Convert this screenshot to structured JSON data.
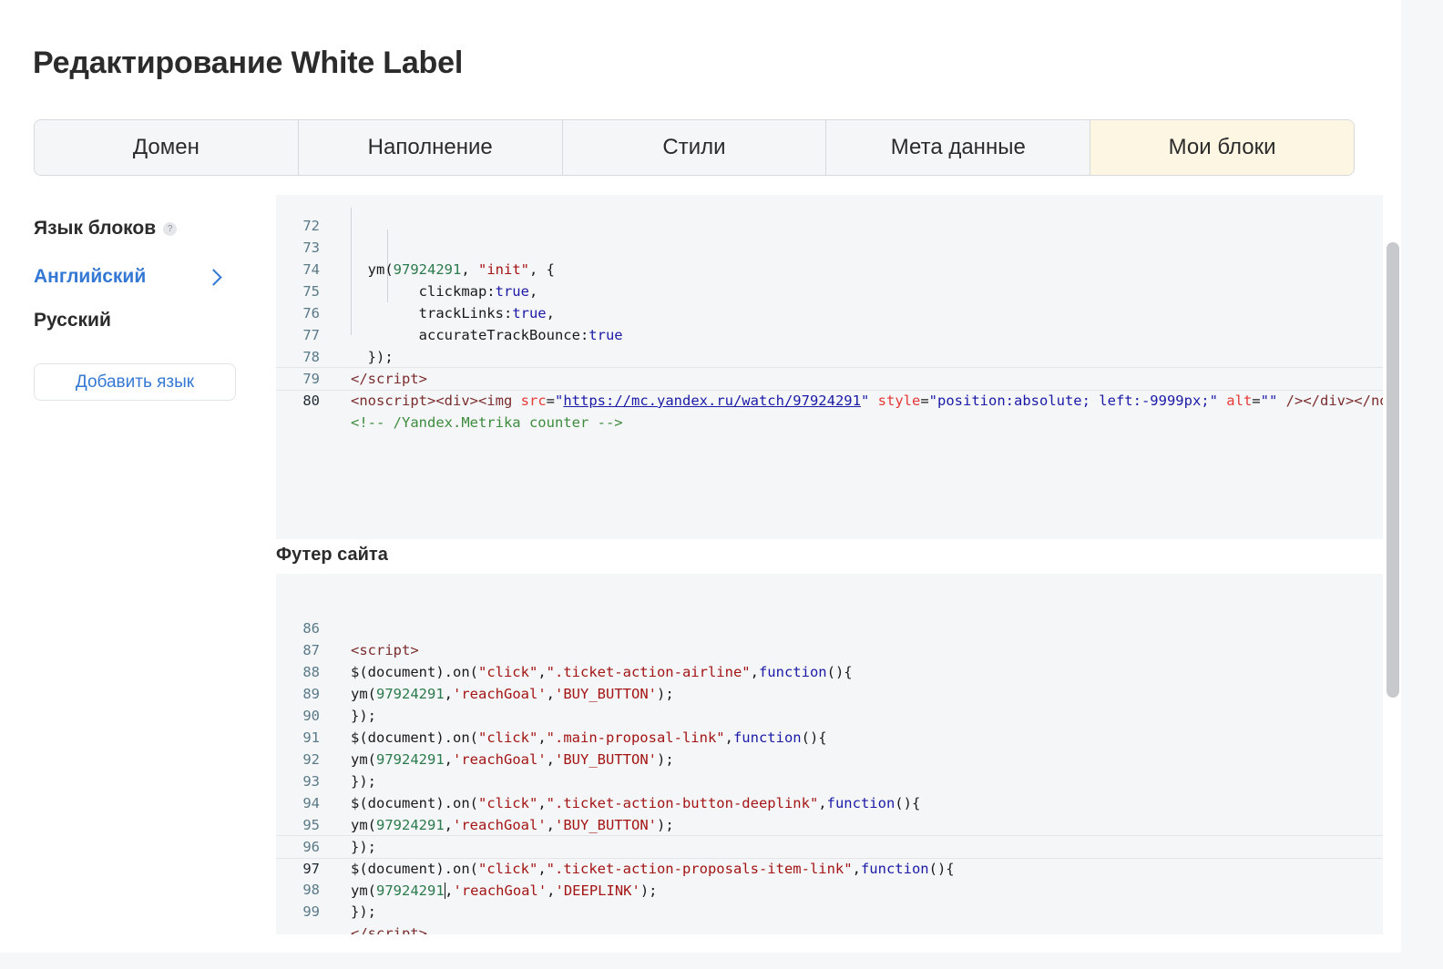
{
  "page": {
    "title": "Редактирование White Label"
  },
  "tabs": [
    {
      "label": "Домен",
      "active": false
    },
    {
      "label": "Наполнение",
      "active": false
    },
    {
      "label": "Стили",
      "active": false
    },
    {
      "label": "Мета данные",
      "active": false
    },
    {
      "label": "Мои блоки",
      "active": true
    }
  ],
  "sidebar": {
    "title": "Язык блоков",
    "help_icon": "?",
    "languages": [
      {
        "label": "Английский",
        "selected": true
      },
      {
        "label": "Русский",
        "selected": false
      }
    ],
    "add_language_label": "Добавить язык"
  },
  "editor_header": {
    "lines": [
      {
        "n": "72"
      },
      {
        "n": "73"
      },
      {
        "n": "74"
      },
      {
        "n": "75"
      },
      {
        "n": "76"
      },
      {
        "n": "77"
      },
      {
        "n": "78"
      },
      {
        "n": "79"
      },
      {
        "n": "80"
      }
    ],
    "active_line": "80",
    "line79_url": "https://mc.yandex.ru/watch/97924291",
    "line80_comment": "<!-- /Yandex.Metrika counter -->"
  },
  "footer_section": {
    "title": "Футер сайта"
  },
  "editor_footer": {
    "lines": [
      {
        "n": "86"
      },
      {
        "n": "87"
      },
      {
        "n": "88"
      },
      {
        "n": "89"
      },
      {
        "n": "90"
      },
      {
        "n": "91"
      },
      {
        "n": "92"
      },
      {
        "n": "93"
      },
      {
        "n": "94"
      },
      {
        "n": "95"
      },
      {
        "n": "96"
      },
      {
        "n": "97"
      },
      {
        "n": "98"
      },
      {
        "n": "99"
      }
    ],
    "active_line": "97",
    "selectors": [
      "\".ticket-action-airline\"",
      "\".main-proposal-link\"",
      "\".ticket-action-button-deeplink\"",
      "\".ticket-action-proposals-item-link\""
    ],
    "goals": [
      "'BUY_BUTTON'",
      "'BUY_BUTTON'",
      "'BUY_BUTTON'",
      "'DEEPLINK'"
    ]
  }
}
